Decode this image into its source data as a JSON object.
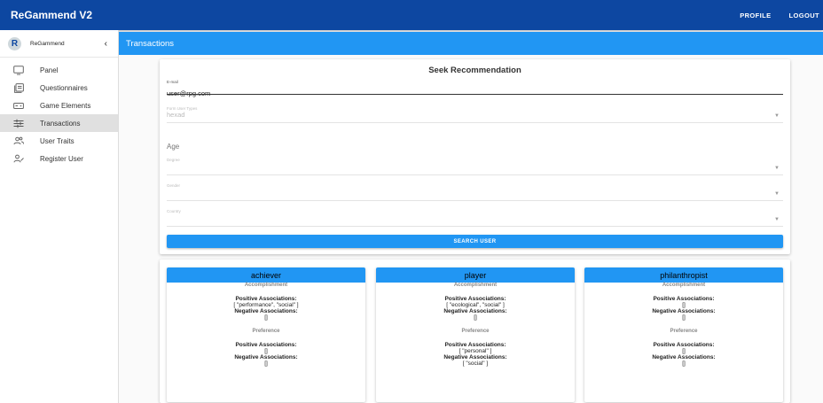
{
  "app": {
    "title": "ReGammend V2"
  },
  "topnav": {
    "profile": "PROFILE",
    "logout": "LOGOUT"
  },
  "drawer": {
    "logo_letter": "R",
    "brand": "ReGammend",
    "collapse_glyph": "‹",
    "items": [
      {
        "label": "Panel",
        "icon": "monitor-icon"
      },
      {
        "label": "Questionnaires",
        "icon": "document-icon"
      },
      {
        "label": "Game Elements",
        "icon": "gamepad-icon"
      },
      {
        "label": "Transactions",
        "icon": "sliders-icon",
        "active": true
      },
      {
        "label": "User Traits",
        "icon": "users-icon"
      },
      {
        "label": "Register User",
        "icon": "person-add-icon"
      }
    ]
  },
  "page": {
    "title": "Transactions"
  },
  "form": {
    "title": "Seek Recommendation",
    "email": {
      "label": "E-mail",
      "value": "user@rpg.com"
    },
    "types": {
      "label": "Form User Types",
      "value": "hexad"
    },
    "age": {
      "placeholder": "Age"
    },
    "degree": {
      "label": "Degree"
    },
    "gender": {
      "label": "Gender"
    },
    "country": {
      "label": "Country"
    },
    "search_button": "SEARCH USER"
  },
  "results": {
    "section_accomplishment": "Accomplishment",
    "section_preference": "Preference",
    "pos_label": "Positive Associations:",
    "neg_label": "Negative Associations:",
    "cards": [
      {
        "name": "achiever",
        "acc_pos": "[ \"performance\", \"social\" ]",
        "acc_neg": "[]",
        "pref_pos": "[]",
        "pref_neg": "[]"
      },
      {
        "name": "player",
        "acc_pos": "[ \"ecological\", \"social\" ]",
        "acc_neg": "[]",
        "pref_pos": "[ \"personal\" ]",
        "pref_neg": "[ \"social\" ]"
      },
      {
        "name": "philanthropist",
        "acc_pos": "[]",
        "acc_neg": "[]",
        "pref_pos": "[]",
        "pref_neg": "[]"
      }
    ]
  }
}
